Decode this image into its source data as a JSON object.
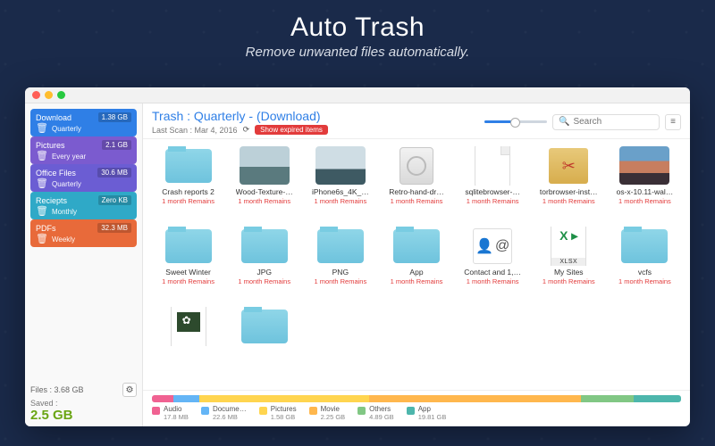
{
  "hero": {
    "title": "Auto Trash",
    "subtitle": "Remove unwanted files automatically."
  },
  "sidebar": {
    "cards": [
      {
        "name": "Download",
        "size": "1.38 GB",
        "schedule": "Quarterly",
        "color": "c-blue"
      },
      {
        "name": "Pictures",
        "size": "2.1 GB",
        "schedule": "Every year",
        "color": "c-purple"
      },
      {
        "name": "Office Files",
        "size": "30.6 MB",
        "schedule": "Quarterly",
        "color": "c-violet"
      },
      {
        "name": "Reciepts",
        "size": "Zero KB",
        "schedule": "Monthly",
        "color": "c-teal"
      },
      {
        "name": "PDFs",
        "size": "32.3 MB",
        "schedule": "Weekly",
        "color": "c-orange"
      }
    ],
    "files_total_label": "Files : 3.68 GB",
    "saved_label": "Saved :",
    "saved_value": "2.5 GB"
  },
  "topbar": {
    "title": "Trash : Quarterly - (Download)",
    "last_scan_label": "Last Scan : Mar 4, 2016",
    "expired_badge": "Show expired items",
    "search_placeholder": "Search"
  },
  "grid": {
    "items": [
      {
        "name": "Crash reports 2",
        "status": "1 month Remains",
        "kind": "folder"
      },
      {
        "name": "Wood-Texture-…",
        "status": "1 month Remains",
        "kind": "image-land1"
      },
      {
        "name": "iPhone6s_4K_…",
        "status": "1 month Remains",
        "kind": "image-land2"
      },
      {
        "name": "Retro-hand-dr…",
        "status": "1 month Remains",
        "kind": "hd"
      },
      {
        "name": "sqlitebrowser-…",
        "status": "1 month Remains",
        "kind": "file"
      },
      {
        "name": "torbrowser-inst…",
        "status": "1 month Remains",
        "kind": "box"
      },
      {
        "name": "os-x-10.11-wal…",
        "status": "1 month Remains",
        "kind": "image-elcap"
      },
      {
        "name": "Sweet Winter",
        "status": "1 month Remains",
        "kind": "folder"
      },
      {
        "name": "JPG",
        "status": "1 month Remains",
        "kind": "folder"
      },
      {
        "name": "PNG",
        "status": "1 month Remains",
        "kind": "folder"
      },
      {
        "name": "App",
        "status": "1 month Remains",
        "kind": "folder"
      },
      {
        "name": "Contact and 1,…",
        "status": "1 month Remains",
        "kind": "vcf"
      },
      {
        "name": "My Sites",
        "status": "1 month Remains",
        "kind": "xlsx"
      },
      {
        "name": "vcfs",
        "status": "1 month Remains",
        "kind": "folder"
      },
      {
        "name": "",
        "status": "",
        "kind": "picfile"
      },
      {
        "name": "",
        "status": "",
        "kind": "folder"
      }
    ]
  },
  "legend": {
    "segments": [
      {
        "label": "Audio",
        "size": "17.8 MB",
        "class": "lb-audio",
        "width": "4%"
      },
      {
        "label": "Docume…",
        "size": "22.6 MB",
        "class": "lb-docs",
        "width": "5%"
      },
      {
        "label": "Pictures",
        "size": "1.58 GB",
        "class": "lb-pics",
        "width": "32%"
      },
      {
        "label": "Movie",
        "size": "2.25 GB",
        "class": "lb-movie",
        "width": "40%"
      },
      {
        "label": "Others",
        "size": "4.89 GB",
        "class": "lb-others",
        "width": "10%"
      },
      {
        "label": "App",
        "size": "19.81 GB",
        "class": "lb-app",
        "width": "9%"
      }
    ]
  }
}
